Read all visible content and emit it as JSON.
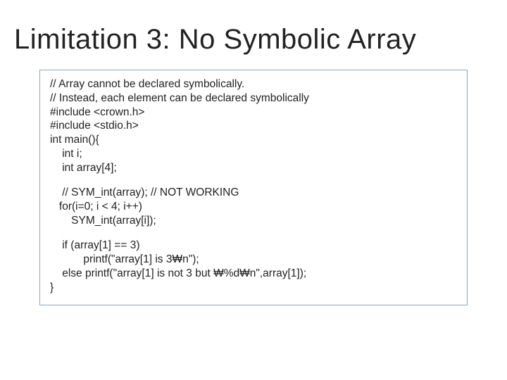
{
  "title": "Limitation 3: No Symbolic Array",
  "code": {
    "l1": "// Array cannot be declared symbolically.",
    "l2": "// Instead, each element can be declared symbolically",
    "l3": "#include <crown.h>",
    "l4": "#include <stdio.h>",
    "l5": "int main(){",
    "l6": "    int i;",
    "l7": "    int array[4];",
    "l8": "    // SYM_int(array); // NOT WORKING",
    "l9": "   for(i=0; i < 4; i++)",
    "l10": "       SYM_int(array[i]);",
    "l11": "    if (array[1] == 3)",
    "l12": "           printf(\"array[1] is 3₩n\");",
    "l13": "    else printf(\"array[1] is not 3 but ₩%d₩n\",array[1]);",
    "l14": "}"
  }
}
